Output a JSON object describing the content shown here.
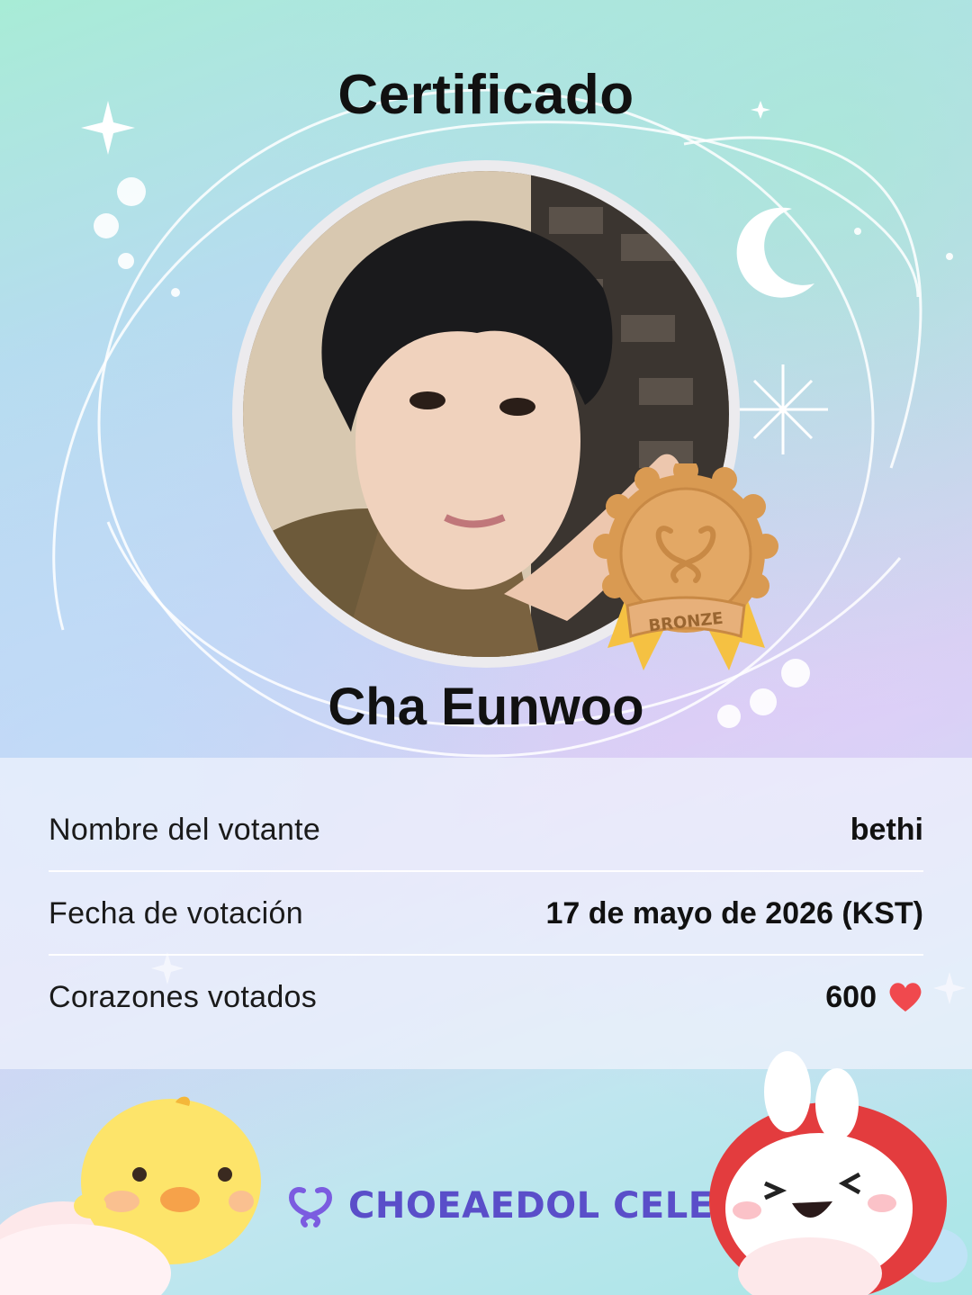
{
  "title": "Certificado",
  "celeb": {
    "name": "Cha Eunwoo"
  },
  "medal": {
    "label": "BRONZE",
    "color": "#d99a52"
  },
  "info": {
    "rows": [
      {
        "label": "Nombre del votante",
        "value": "bethi"
      },
      {
        "label": "Fecha de votación",
        "value": "17 de mayo de 2026 (KST)"
      },
      {
        "label": "Corazones votados",
        "value": "600"
      }
    ]
  },
  "brand": {
    "name": "CHOEAEDOL CELEB",
    "color": "#5a4ec9"
  },
  "icons": [
    "sparkle-icon",
    "moon-icon",
    "heart-icon",
    "bronze-medal-icon",
    "brand-logo-icon",
    "chick-mascot",
    "bunny-mascot"
  ],
  "colors": {
    "heart": "#f0494e",
    "title": "#111111"
  }
}
